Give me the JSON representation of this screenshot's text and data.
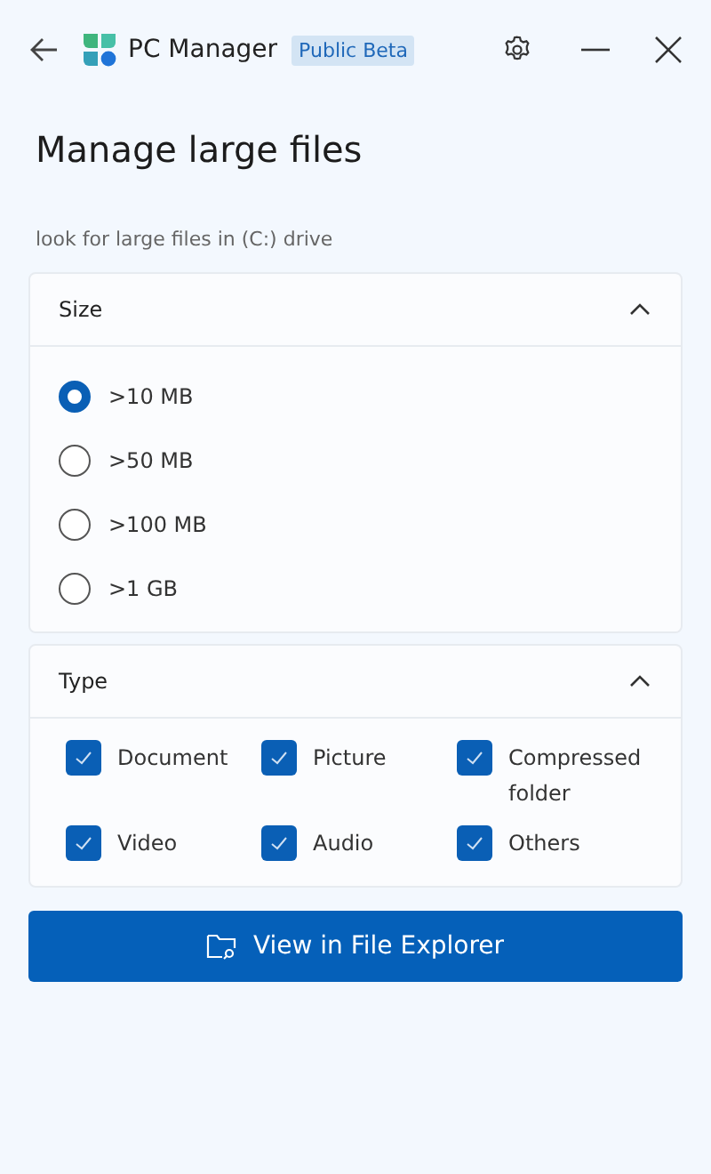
{
  "app": {
    "title": "PC Manager",
    "badge": "Public Beta"
  },
  "page": {
    "title": "Manage large files",
    "subtitle": "look for large files in (C:) drive"
  },
  "size_section": {
    "title": "Size",
    "expanded": true,
    "options": [
      {
        "label": ">10 MB",
        "selected": true
      },
      {
        "label": ">50 MB",
        "selected": false
      },
      {
        "label": ">100 MB",
        "selected": false
      },
      {
        "label": ">1 GB",
        "selected": false
      }
    ]
  },
  "type_section": {
    "title": "Type",
    "expanded": true,
    "options": [
      {
        "label": "Document",
        "checked": true
      },
      {
        "label": "Picture",
        "checked": true
      },
      {
        "label": "Compressed folder",
        "checked": true
      },
      {
        "label": "Video",
        "checked": true
      },
      {
        "label": "Audio",
        "checked": true
      },
      {
        "label": "Others",
        "checked": true
      }
    ]
  },
  "action_button": {
    "label": "View in File Explorer"
  }
}
